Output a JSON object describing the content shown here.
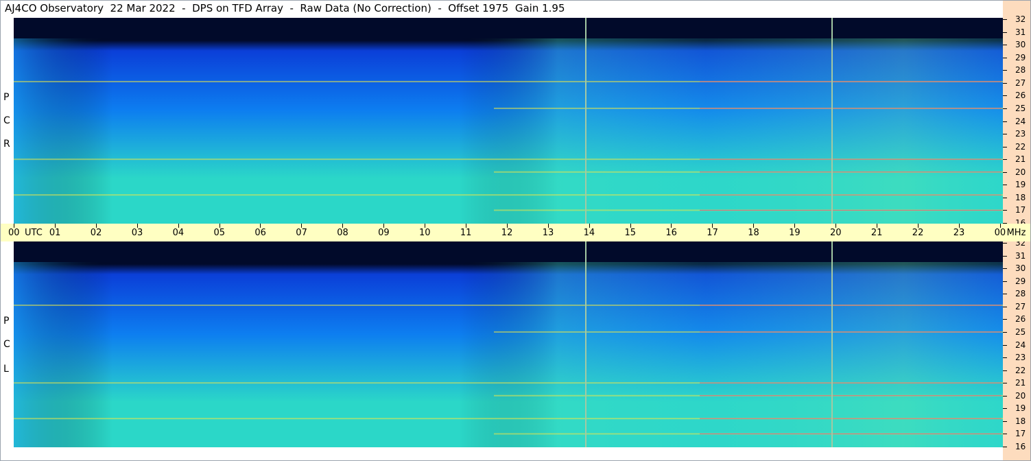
{
  "title": "AJ4CO Observatory  22 Mar 2022  -  DPS on TFD Array  -  Raw Data (No Correction)  -  Offset 1975  Gain 1.95",
  "panels": [
    {
      "id": "rcp",
      "label": [
        "R",
        "C",
        "P"
      ]
    },
    {
      "id": "lcp",
      "label": [
        "L",
        "C",
        "P"
      ]
    }
  ],
  "freq_labels": [
    "32",
    "31",
    "30",
    "29",
    "28",
    "27",
    "26",
    "25",
    "24",
    "23",
    "22",
    "21",
    "20",
    "19",
    "18",
    "17",
    "16"
  ],
  "time_labels": [
    "00",
    "UTC",
    "01",
    "02",
    "03",
    "04",
    "05",
    "06",
    "07",
    "08",
    "09",
    "10",
    "11",
    "12",
    "13",
    "14",
    "15",
    "16",
    "17",
    "18",
    "19",
    "20",
    "21",
    "22",
    "23",
    "00",
    "MHz"
  ],
  "colors": {
    "background_dark": "#010a2a",
    "low": "#0b3fd8",
    "mid": "#0d7ef0",
    "high": "#2bd7c8",
    "hot": "#e8e84a",
    "peak": "#e24a8a",
    "freq_axis_bg": "#fddcbe",
    "time_axis_bg": "#ffffc2",
    "marker": "#a3c9a3"
  },
  "chart_data": {
    "type": "heatmap",
    "title": "AJ4CO Observatory  22 Mar 2022  -  DPS on TFD Array  -  Raw Data (No Correction)  -  Offset 1975  Gain 1.95",
    "x_range_utc_hours": [
      0,
      24
    ],
    "y_range_mhz": [
      16,
      32
    ],
    "x_ticks": [
      "00",
      "01",
      "02",
      "03",
      "04",
      "05",
      "06",
      "07",
      "08",
      "09",
      "10",
      "11",
      "12",
      "13",
      "14",
      "15",
      "16",
      "17",
      "18",
      "19",
      "20",
      "21",
      "22",
      "23",
      "00"
    ],
    "y_ticks": [
      32,
      31,
      30,
      29,
      28,
      27,
      26,
      25,
      24,
      23,
      22,
      21,
      20,
      19,
      18,
      17,
      16
    ],
    "panels": [
      "RCP",
      "LCP"
    ],
    "vertical_markers_utc": [
      13.9,
      19.9
    ],
    "horizontal_bands_mhz": [
      27.1,
      25.0,
      21.0,
      20.0,
      18.2,
      17.0
    ]
  }
}
